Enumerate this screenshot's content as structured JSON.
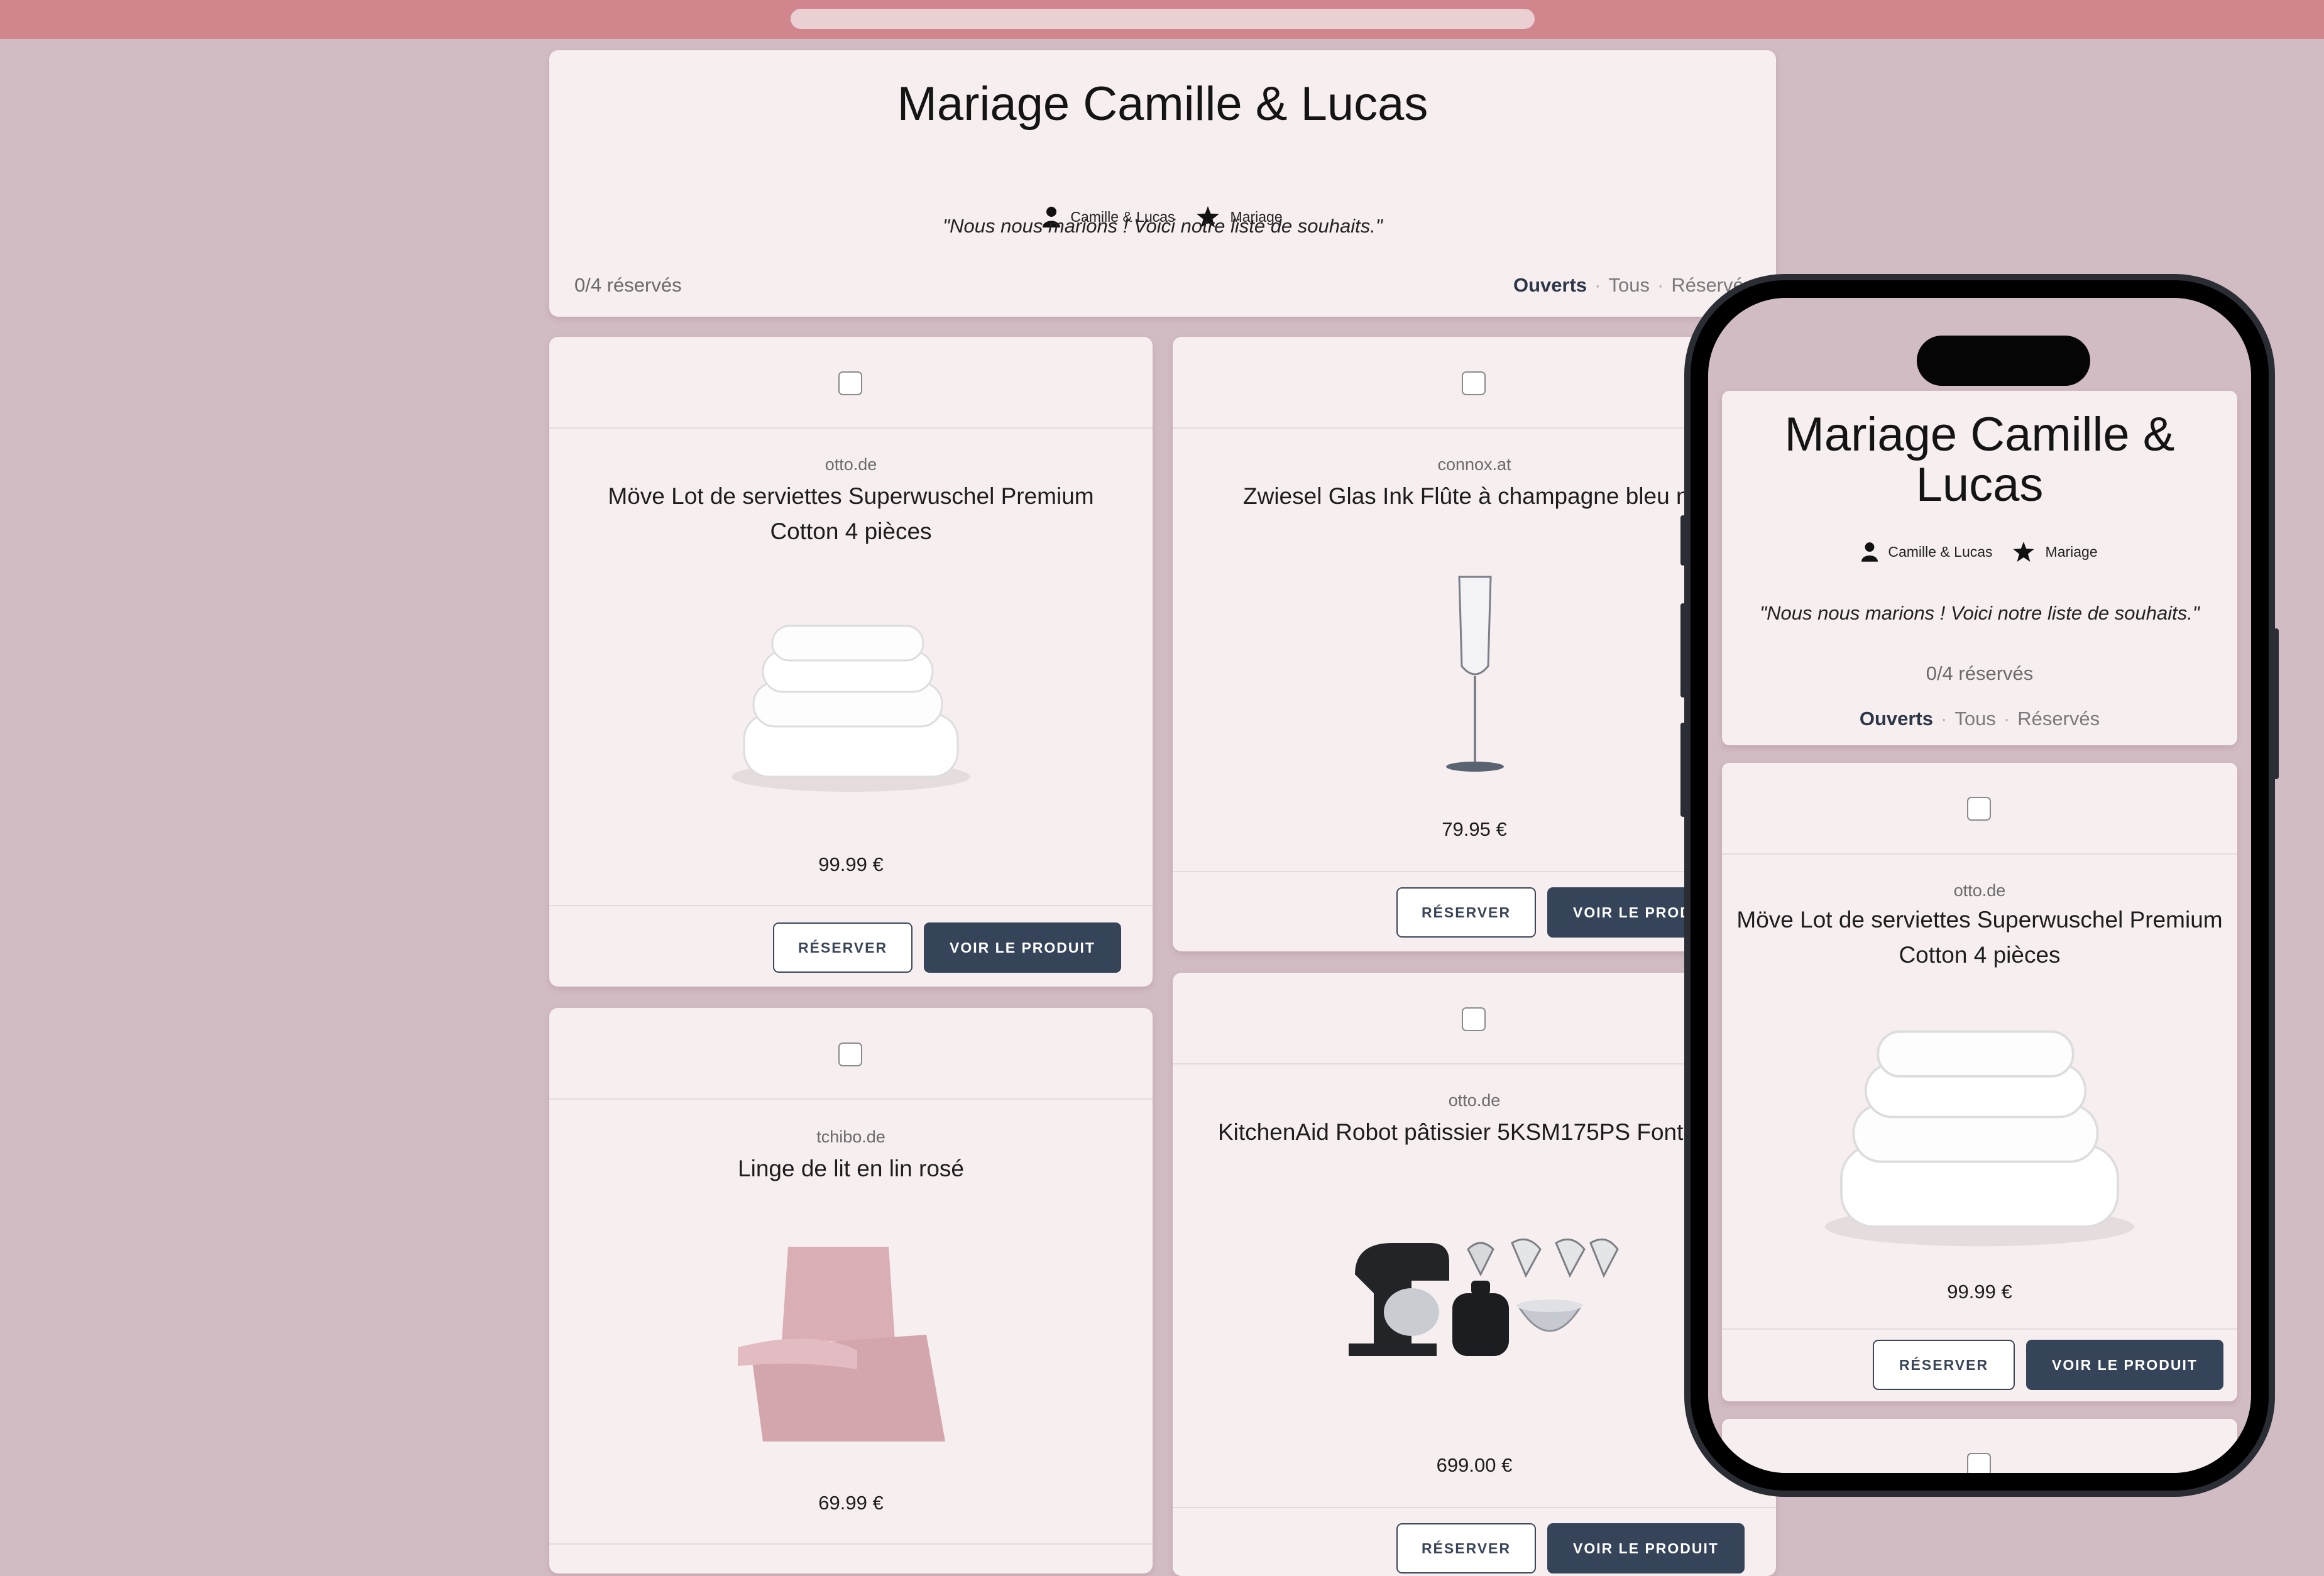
{
  "registry": {
    "title": "Mariage Camille & Lucas",
    "owner": "Camille & Lucas",
    "occasion": "Mariage",
    "message": "\"Nous nous marions ! Voici notre liste de souhaits.\"",
    "reserved_count": "0/4 réservés",
    "filters": [
      "Ouverts",
      "Tous",
      "Réservés"
    ],
    "active_filter": "Ouverts"
  },
  "products": [
    {
      "store": "otto.de",
      "name": "Möve Lot de serviettes Superwuschel Premium Cotton 4 pièces",
      "price": "99.99 €",
      "image": "towels"
    },
    {
      "store": "connox.at",
      "name": "Zwiesel Glas Ink Flûte à champagne bleu nu",
      "price": "79.95 €",
      "image": "champagne-flute"
    },
    {
      "store": "tchibo.de",
      "name": "Linge de lit en lin rosé",
      "price": "69.99 €",
      "image": "bed-linen"
    },
    {
      "store": "otto.de",
      "name": "KitchenAid Robot pâtissier 5KSM175PS Fonte",
      "price": "699.00 €",
      "image": "stand-mixer"
    }
  ],
  "buttons": {
    "reserve": "RÉSERVER",
    "view": "VOIR LE PRODUIT"
  },
  "mobile": {
    "title": "Mariage Camille & Lucas"
  }
}
